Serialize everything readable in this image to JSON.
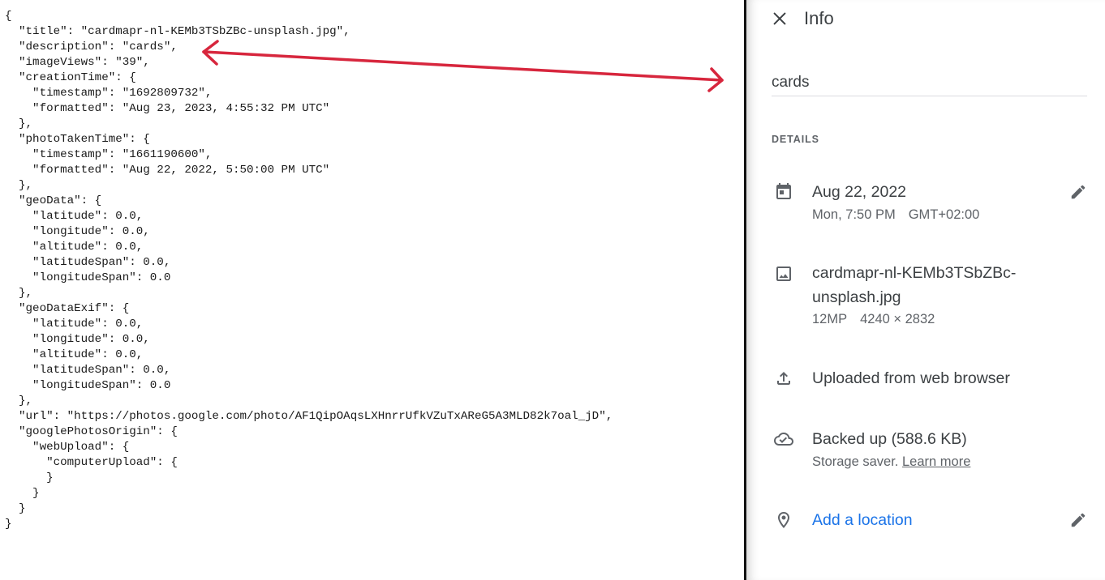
{
  "json_text": {
    "lines": [
      "{",
      "  \"title\": \"cardmapr-nl-KEMb3TSbZBc-unsplash.jpg\",",
      "  \"description\": \"cards\",",
      "  \"imageViews\": \"39\",",
      "  \"creationTime\": {",
      "    \"timestamp\": \"1692809732\",",
      "    \"formatted\": \"Aug 23, 2023, 4:55:32 PM UTC\"",
      "  },",
      "  \"photoTakenTime\": {",
      "    \"timestamp\": \"1661190600\",",
      "    \"formatted\": \"Aug 22, 2022, 5:50:00 PM UTC\"",
      "  },",
      "  \"geoData\": {",
      "    \"latitude\": 0.0,",
      "    \"longitude\": 0.0,",
      "    \"altitude\": 0.0,",
      "    \"latitudeSpan\": 0.0,",
      "    \"longitudeSpan\": 0.0",
      "  },",
      "  \"geoDataExif\": {",
      "    \"latitude\": 0.0,",
      "    \"longitude\": 0.0,",
      "    \"altitude\": 0.0,",
      "    \"latitudeSpan\": 0.0,",
      "    \"longitudeSpan\": 0.0",
      "  },",
      "  \"url\": \"https://photos.google.com/photo/AF1QipOAqsLXHnrrUfkVZuTxAReG5A3MLD82k7oal_jD\",",
      "  \"googlePhotosOrigin\": {",
      "    \"webUpload\": {",
      "      \"computerUpload\": {",
      "      }",
      "    }",
      "  }",
      "}"
    ]
  },
  "arrow": {
    "color": "#d7263d"
  },
  "info_panel": {
    "title": "Info",
    "close_icon": "close-icon",
    "description_value": "cards",
    "details_heading": "DETAILS",
    "date": {
      "icon": "calendar-icon",
      "main": "Aug 22, 2022",
      "sub_time": "Mon, 7:50 PM",
      "sub_tz": "GMT+02:00",
      "edit_icon": "pencil-icon"
    },
    "file": {
      "icon": "image-icon",
      "name_line1": "cardmapr-nl-KEMb3TSbZBc-",
      "name_line2": "unsplash.jpg",
      "megapixels": "12MP",
      "dimensions": "4240 × 2832"
    },
    "upload": {
      "icon": "upload-icon",
      "text": "Uploaded from web browser"
    },
    "backup": {
      "icon": "cloud-done-icon",
      "main": "Backed up (588.6 KB)",
      "sub": "Storage saver.",
      "link": "Learn more"
    },
    "location": {
      "icon": "location-pin-icon",
      "link": "Add a location",
      "edit_icon": "pencil-icon"
    },
    "link_color": "#1a73e8",
    "text_color": "#3c4043",
    "secondary_color": "#5f6368"
  }
}
